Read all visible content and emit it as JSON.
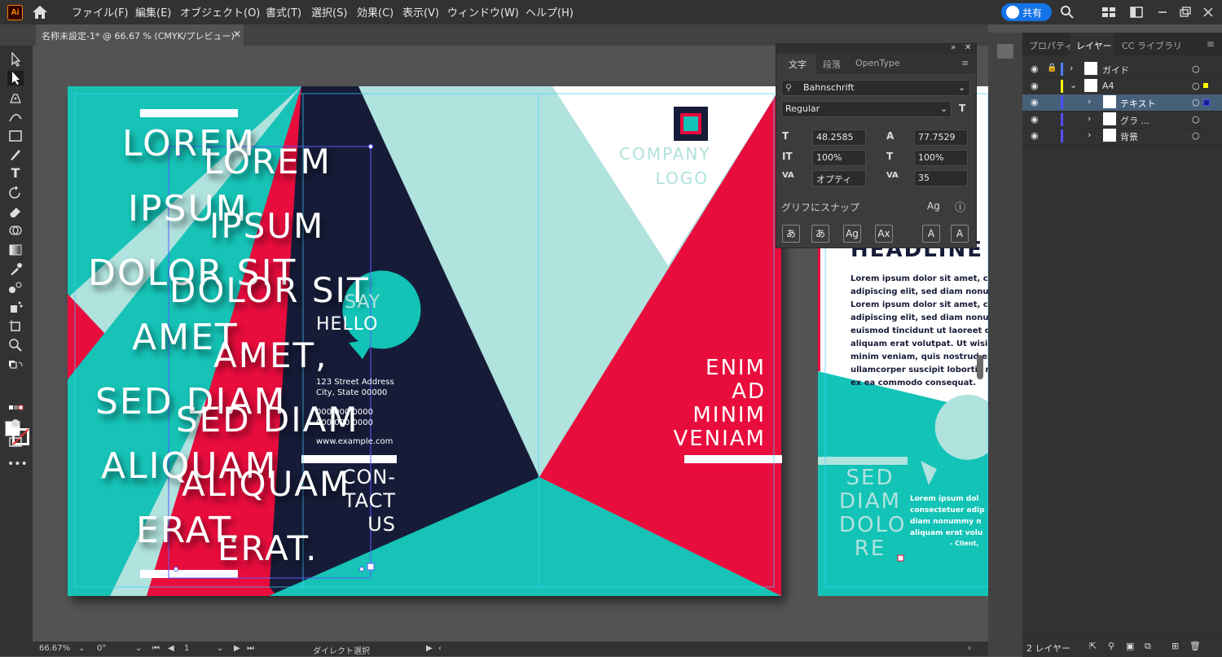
{
  "app": {
    "logo": "Ai",
    "menu": [
      "ファイル(F)",
      "編集(E)",
      "オブジェクト(O)",
      "書式(T)",
      "選択(S)",
      "効果(C)",
      "表示(V)",
      "ウィンドウ(W)",
      "ヘルプ(H)"
    ],
    "share_label": "共有"
  },
  "document": {
    "tab_title": "名称未設定-1* @ 66.67 % (CMYK/プレビュー)"
  },
  "artwork": {
    "stack_a": [
      "LOREM",
      "IPSUM",
      "DOLOR SIT",
      "AMET,",
      "SED DIAM",
      "ALIQUAM",
      "ERAT."
    ],
    "stack_b": [
      "LOREM",
      "IPSUM",
      "DOLOR SIT",
      "AMET,",
      "SED DIAM",
      "ALIQUAM",
      "ERAT."
    ],
    "say_hello": [
      "SAY",
      "HELLO"
    ],
    "address": [
      "123 Street Address",
      "City, State 00000"
    ],
    "phone": [
      "000.000.0000",
      "000.000.0000"
    ],
    "website": "www.example.com",
    "contact": [
      "CON-",
      "TACT",
      "US"
    ],
    "company_logo": [
      "COMPANY",
      "LOGO"
    ],
    "enim": [
      "ENIM",
      "AD",
      "MINIM",
      "VENIAM"
    ],
    "headline": "HEADLINE",
    "body_lines": [
      "Lorem ipsum dolor sit amet, co",
      "adipiscing elit, sed diam nonum",
      "Lorem ipsum dolor sit amet, co",
      "adipiscing elit, sed diam nonum",
      "euismod tincidunt ut laoreet do",
      "aliquam erat volutpat. Ut wisi e",
      "minim veniam, quis nostrud exe",
      "ullamcorper suscipit lobortis n",
      "ex ea commodo consequat."
    ],
    "sed_diam": [
      "SED",
      "DIAM",
      "DOLO",
      "RE"
    ],
    "quote_lines": [
      "Lorem ipsum dol",
      "consectetuer adip",
      "diam nonummy n",
      "aliquam erat volu"
    ],
    "client": "- Client,"
  },
  "char_panel": {
    "tabs": [
      "文字",
      "段落",
      "OpenType"
    ],
    "font_family": "Bahnschrift",
    "font_style": "Regular",
    "font_size": "48.2585",
    "leading": "77.7529",
    "vscale": "100%",
    "hscale": "100%",
    "kerning": "オプティ",
    "tracking": "35",
    "snap_label": "グリフにスナップ",
    "glyph_buttons": [
      "あ",
      "あ",
      "Ag",
      "Ax",
      "A",
      "A"
    ]
  },
  "layers_panel": {
    "tabs": [
      "プロパティ",
      "レイヤー",
      "CC ライブラリ"
    ],
    "rows": [
      {
        "name": "ガイド",
        "color": "#4f7fff",
        "selected": false
      },
      {
        "name": "A4",
        "color": "#ffff00",
        "selected": false
      },
      {
        "name": "テキスト",
        "color": "#4f4fff",
        "selected": true
      },
      {
        "name": "グラ ...",
        "color": "#4f4fff",
        "selected": false
      },
      {
        "name": "背景",
        "color": "#4f4fff",
        "selected": false
      }
    ],
    "footer_count": "2 レイヤー"
  },
  "status": {
    "zoom": "66.67%",
    "rotation": "0°",
    "artboard": "1",
    "tool_name": "ダイレクト選択"
  },
  "colors": {
    "teal": "#12c3b6",
    "light_teal": "#b0e2de",
    "navy": "#161b38",
    "red": "#e8083d",
    "accent_blue": "#1473e6"
  }
}
